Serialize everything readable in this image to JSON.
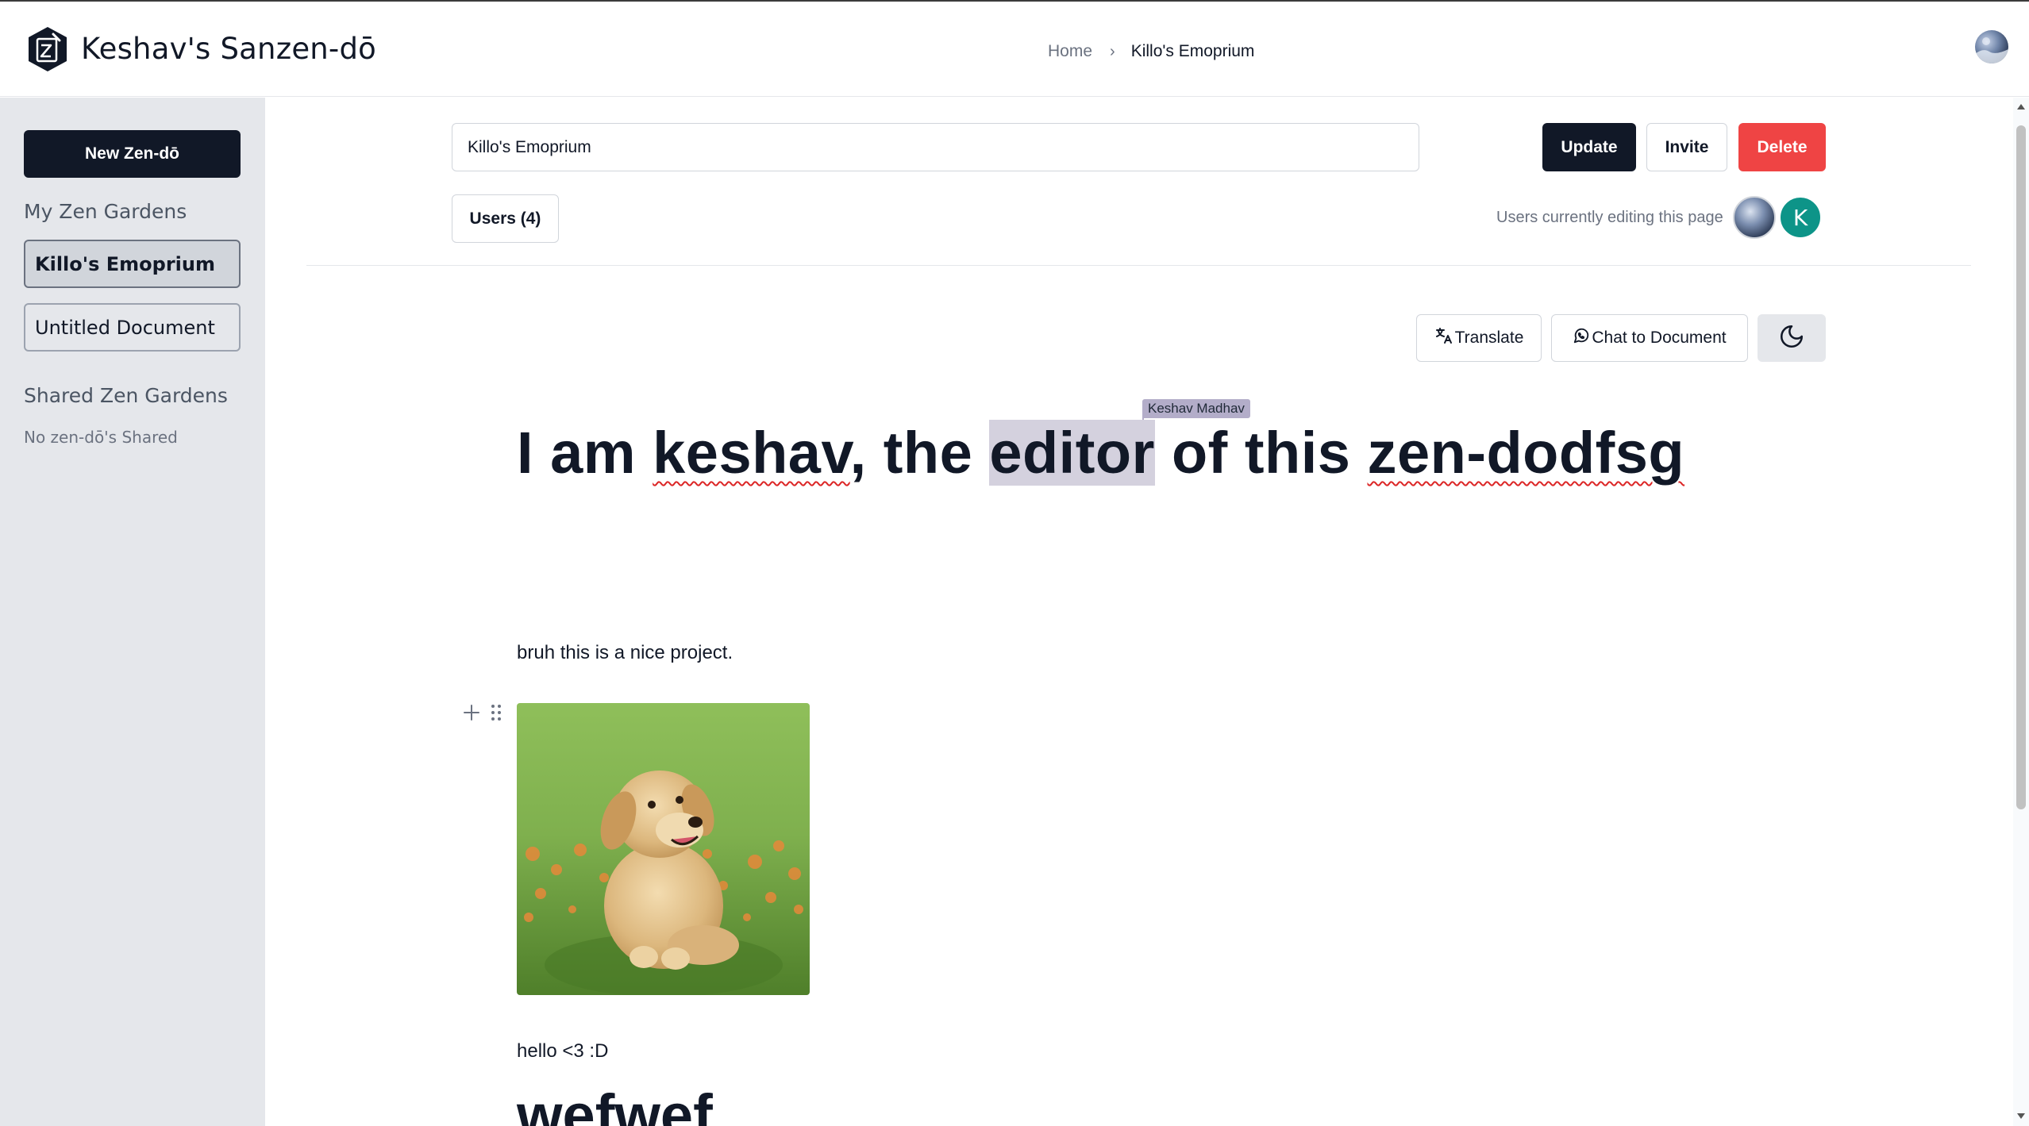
{
  "header": {
    "app_title": "Keshav's Sanzen-dō",
    "breadcrumb": {
      "home": "Home",
      "separator": "›",
      "current": "Killo's Emoprium"
    },
    "logo_icon": "zen-do-hexagon-logo",
    "avatar_icon": "user-avatar"
  },
  "sidebar": {
    "new_button": "New Zen-dō",
    "my_heading": "My Zen Gardens",
    "my_items": [
      {
        "label": "Killo's Emoprium",
        "active": true
      },
      {
        "label": "Untitled Document",
        "active": false
      }
    ],
    "shared_heading": "Shared Zen Gardens",
    "shared_empty": "No zen-dō's Shared"
  },
  "toolbar": {
    "title_value": "Killo's Emoprium",
    "update_label": "Update",
    "invite_label": "Invite",
    "delete_label": "Delete",
    "users_label": "Users (4)",
    "editing_label": "Users currently editing this page",
    "editor_initial": "K",
    "translate_label": "Translate",
    "chat_label": "Chat to Document",
    "theme_icon": "moon-icon"
  },
  "document": {
    "cursor_name": "Keshav Madhav",
    "heading_part1": "I am ",
    "heading_word_keshav": "keshav",
    "heading_part2": ", the ",
    "heading_selected": "editor",
    "heading_part3": " of this ",
    "heading_word_zen": "zen-dodfsg",
    "paragraph1": "bruh this is a nice project.",
    "image_subject": "golden retriever puppy on grass",
    "paragraph2": "hello <3 :D",
    "heading2": "wefwef"
  },
  "colors": {
    "primary": "#111827",
    "danger": "#ef4444",
    "sidebar_bg": "#e5e7eb",
    "editor_avatar": "#0d9488",
    "cursor_tag": "#b3adc9"
  }
}
